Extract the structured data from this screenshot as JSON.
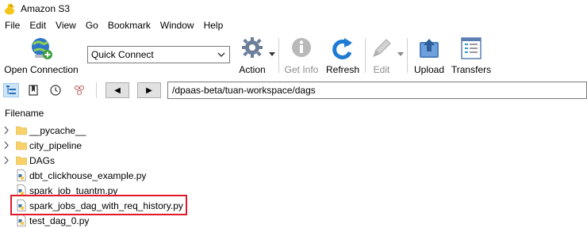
{
  "window": {
    "title": "Amazon S3",
    "app_icon": "duck-icon"
  },
  "menu": [
    "File",
    "Edit",
    "View",
    "Go",
    "Bookmark",
    "Window",
    "Help"
  ],
  "toolbar": {
    "open_connection": "Open Connection",
    "quick_connect": "Quick Connect",
    "action": "Action",
    "get_info": "Get Info",
    "refresh": "Refresh",
    "edit": "Edit",
    "upload": "Upload",
    "transfers": "Transfers"
  },
  "nav": {
    "back": "◀",
    "forward": "▶",
    "path": "/dpaas-beta/tuan-workspace/dags"
  },
  "list": {
    "header": "Filename",
    "items": [
      {
        "name": "__pycache__",
        "type": "folder"
      },
      {
        "name": "city_pipeline",
        "type": "folder"
      },
      {
        "name": "DAGs",
        "type": "folder"
      },
      {
        "name": "dbt_clickhouse_example.py",
        "type": "file"
      },
      {
        "name": "spark_job_tuantm.py",
        "type": "file"
      },
      {
        "name": "spark_jobs_dag_with_req_history.py",
        "type": "file",
        "highlighted": true
      },
      {
        "name": "test_dag_0.py",
        "type": "file"
      }
    ]
  },
  "colors": {
    "highlight": "#e0192b",
    "folder": "#f7d26a"
  }
}
